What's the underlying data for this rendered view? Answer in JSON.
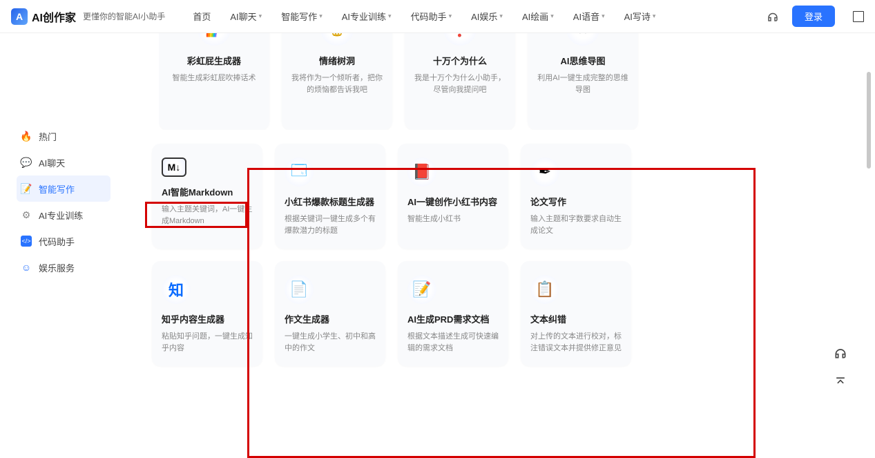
{
  "brand": {
    "name": "AI创作家",
    "tagline": "更懂你的智能AI小助手"
  },
  "nav": {
    "items": [
      {
        "label": "首页",
        "dd": false
      },
      {
        "label": "AI聊天",
        "dd": true
      },
      {
        "label": "智能写作",
        "dd": true
      },
      {
        "label": "AI专业训练",
        "dd": true
      },
      {
        "label": "代码助手",
        "dd": true
      },
      {
        "label": "AI娱乐",
        "dd": true
      },
      {
        "label": "AI绘画",
        "dd": true
      },
      {
        "label": "AI语音",
        "dd": true
      },
      {
        "label": "AI写诗",
        "dd": true
      }
    ]
  },
  "login_label": "登录",
  "sidebar": {
    "items": [
      {
        "label": "热门",
        "icon": "🔥",
        "color": "#2973ff"
      },
      {
        "label": "AI聊天",
        "icon": "💬",
        "color": "#2cb6ff"
      },
      {
        "label": "智能写作",
        "icon": "📝",
        "color": "#2973ff",
        "active": true
      },
      {
        "label": "AI专业训练",
        "icon": "⚙",
        "color": "#888"
      },
      {
        "label": "代码助手",
        "icon": "⌨",
        "color": "#2973ff"
      },
      {
        "label": "娱乐服务",
        "icon": "☺",
        "color": "#2973ff"
      }
    ]
  },
  "top_row": [
    {
      "title": "彩虹屁生成器",
      "desc": "智能生成彩虹屁吹捧话术",
      "icon": "🌈"
    },
    {
      "title": "情绪树洞",
      "desc": "我将作为一个倾听者，把你的烦恼都告诉我吧",
      "icon": "🗑"
    },
    {
      "title": "十万个为什么",
      "desc": "我是十万个为什么小助手，尽管向我提问吧",
      "icon": "❓"
    },
    {
      "title": "AI思维导图",
      "desc": "利用AI一键生成完整的思维导图",
      "icon": "✖"
    }
  ],
  "grid": [
    [
      {
        "title": "AI智能Markdown",
        "desc": "输入主题关键词，AI一键生成Markdown",
        "icon": "M↓"
      },
      {
        "title": "小红书爆款标题生成器",
        "desc": "根据关键词一键生成多个有爆款潜力的标题",
        "icon": "🗔"
      },
      {
        "title": "AI一键创作小红书内容",
        "desc": "智能生成小红书",
        "icon": "📕"
      },
      {
        "title": "论文写作",
        "desc": "输入主题和字数要求自动生成论文",
        "icon": "✒"
      }
    ],
    [
      {
        "title": "知乎内容生成器",
        "desc": "粘贴知乎问题，一键生成知乎内容",
        "icon": "知"
      },
      {
        "title": "作文生成器",
        "desc": "一键生成小学生、初中和高中的作文",
        "icon": "📄"
      },
      {
        "title": "AI生成PRD需求文档",
        "desc": "根据文本描述生成可快速编辑的需求文档",
        "icon": "📝"
      },
      {
        "title": "文本纠错",
        "desc": "对上传的文本进行校对，标注错误文本并提供修正意见",
        "icon": "📋"
      }
    ]
  ]
}
